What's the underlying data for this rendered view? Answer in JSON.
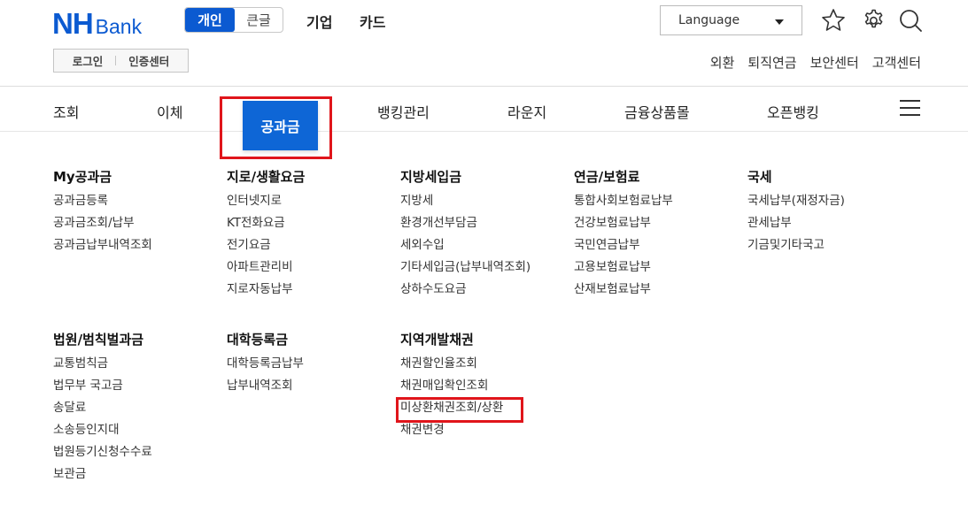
{
  "header": {
    "logo": {
      "nh": "NH",
      "bank": "Bank"
    },
    "segment": {
      "active": "개인",
      "inactive": "큰글"
    },
    "top_links": [
      "기업",
      "카드"
    ],
    "language_label": "Language",
    "login_box": {
      "login": "로그인",
      "cert": "인증센터"
    },
    "util_links": [
      "외환",
      "퇴직연금",
      "보안센터",
      "고객센터"
    ],
    "accent": "#0b5ad1",
    "highlight": "#e0151b"
  },
  "gnb": {
    "items": [
      "조회",
      "이체",
      "공과금",
      "뱅킹관리",
      "라운지",
      "금융상품몰",
      "오픈뱅킹"
    ]
  },
  "menu": {
    "row1": [
      {
        "title": "My공과금",
        "items": [
          "공과금등록",
          "공과금조회/납부",
          "공과금납부내역조회"
        ]
      },
      {
        "title": "지로/생활요금",
        "items": [
          "인터넷지로",
          "KT전화요금",
          "전기요금",
          "아파트관리비",
          "지로자동납부"
        ]
      },
      {
        "title": "지방세입금",
        "items": [
          "지방세",
          "환경개선부담금",
          "세외수입",
          "기타세입금(납부내역조회)",
          "상하수도요금"
        ]
      },
      {
        "title": "연금/보험료",
        "items": [
          "통합사회보험료납부",
          "건강보험료납부",
          "국민연금납부",
          "고용보험료납부",
          "산재보험료납부"
        ]
      },
      {
        "title": "국세",
        "items": [
          "국세납부(재정자금)",
          "관세납부",
          "기금및기타국고"
        ]
      }
    ],
    "row2": [
      {
        "title": "법원/범칙벌과금",
        "items": [
          "교통범칙금",
          "법무부 국고금",
          "송달료",
          "소송등인지대",
          "법원등기신청수수료",
          "보관금"
        ]
      },
      {
        "title": "대학등록금",
        "items": [
          "대학등록금납부",
          "납부내역조회"
        ]
      },
      {
        "title": "지역개발채권",
        "items": [
          "채권할인율조회",
          "채권매입확인조회",
          "미상환채권조회/상환",
          "채권변경"
        ]
      }
    ]
  }
}
